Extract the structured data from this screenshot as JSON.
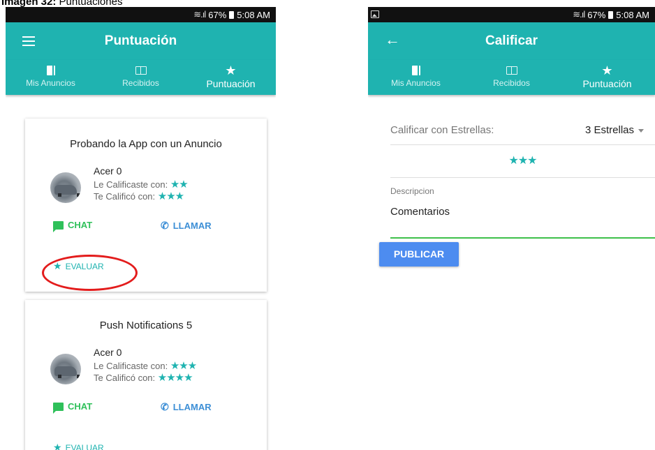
{
  "caption": {
    "label": "Imagen 32:",
    "text": "Puntuaciones"
  },
  "left": {
    "status": {
      "signal": "☰…━━",
      "battery": "67%",
      "time": "5:08 AM"
    },
    "title": "Puntuación",
    "tabs": [
      {
        "label": "Mis Anuncios",
        "icon": "book-icon"
      },
      {
        "label": "Recibidos",
        "icon": "open-book-icon"
      },
      {
        "label": "Puntuación",
        "icon": "star-icon",
        "active": true
      }
    ],
    "cards": [
      {
        "title": "Probando la App con un Anuncio",
        "user": "Acer 0",
        "given_label": "Le Calificaste con:",
        "given_stars": "★★",
        "received_label": "Te Calificó con:",
        "received_stars": "★★★",
        "chat_label": "CHAT",
        "call_label": "LLAMAR",
        "eval_label": "EVALUAR"
      },
      {
        "title": "Push Notifications 5",
        "user": "Acer 0",
        "given_label": "Le Calificaste con:",
        "given_stars": "★★★",
        "received_label": "Te Calificó con:",
        "received_stars": "★★★★",
        "chat_label": "CHAT",
        "call_label": "LLAMAR",
        "eval_label": "EVALUAR"
      }
    ]
  },
  "right": {
    "status": {
      "battery": "67%",
      "time": "5:08 AM"
    },
    "title": "Calificar",
    "tabs": [
      {
        "label": "Mis Anuncios",
        "icon": "book-icon"
      },
      {
        "label": "Recibidos",
        "icon": "open-book-icon"
      },
      {
        "label": "Puntuación",
        "icon": "star-icon",
        "active": true
      }
    ],
    "rate_label": "Calificar con Estrellas:",
    "rate_value": "3 Estrellas",
    "stars": "★★★",
    "desc_label": "Descripcion",
    "desc_value": "Comentarios",
    "publish_label": "PUBLICAR"
  },
  "colors": {
    "primary": "#1fb3b0",
    "chat": "#2fc05a",
    "call": "#3d8fd6",
    "publish": "#4d8cf0",
    "highlight": "#e31c1c"
  }
}
